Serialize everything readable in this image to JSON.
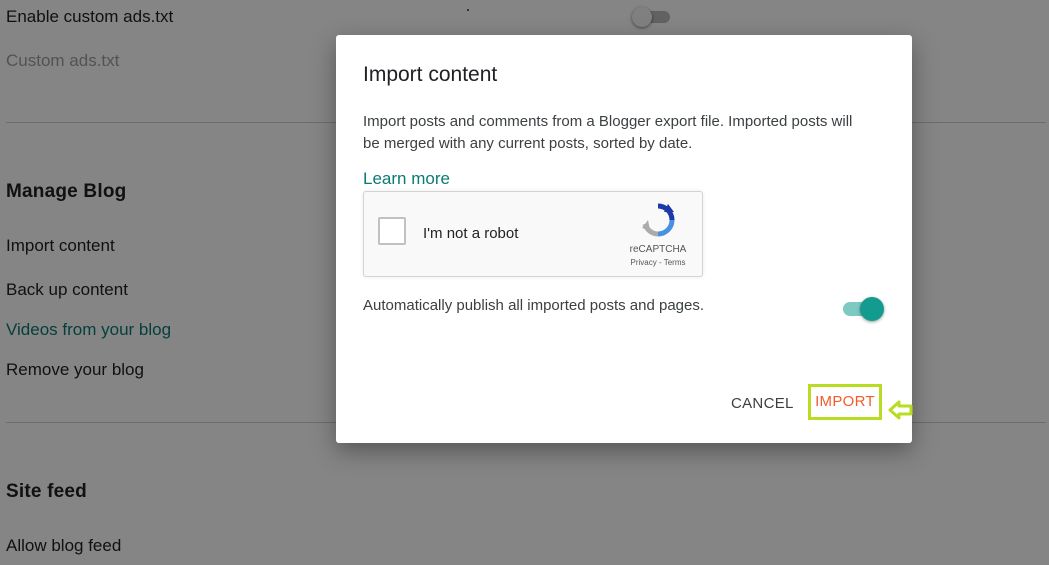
{
  "background": {
    "enable_custom_ads": "Enable custom ads.txt",
    "custom_ads": "Custom ads.txt",
    "manage_blog_heading": "Manage Blog",
    "import_content": "Import content",
    "back_up_content": "Back up content",
    "videos_from_blog": "Videos from your blog",
    "remove_blog": "Remove your blog",
    "site_feed_heading": "Site feed",
    "allow_blog_feed": "Allow blog feed"
  },
  "dialog": {
    "title": "Import content",
    "description": "Import posts and comments from a Blogger export file. Imported posts will be merged with any current posts, sorted by date.",
    "learn_more": "Learn more",
    "captcha": {
      "label": "I'm not a robot",
      "brand": "reCAPTCHA",
      "privacy": "Privacy",
      "separator": "-",
      "terms": "Terms"
    },
    "auto_publish_label": "Automatically publish all imported posts and pages.",
    "auto_publish_enabled": true,
    "cancel_label": "CANCEL",
    "import_label": "IMPORT"
  },
  "colors": {
    "accent_teal": "#139b8f",
    "link_teal": "#0b7a75",
    "import_text": "#f25c2a",
    "highlight_border": "#b7dc22"
  },
  "icons": {
    "captcha_logo": "recaptcha-logo-icon",
    "hint_arrow": "arrow-left-icon"
  }
}
